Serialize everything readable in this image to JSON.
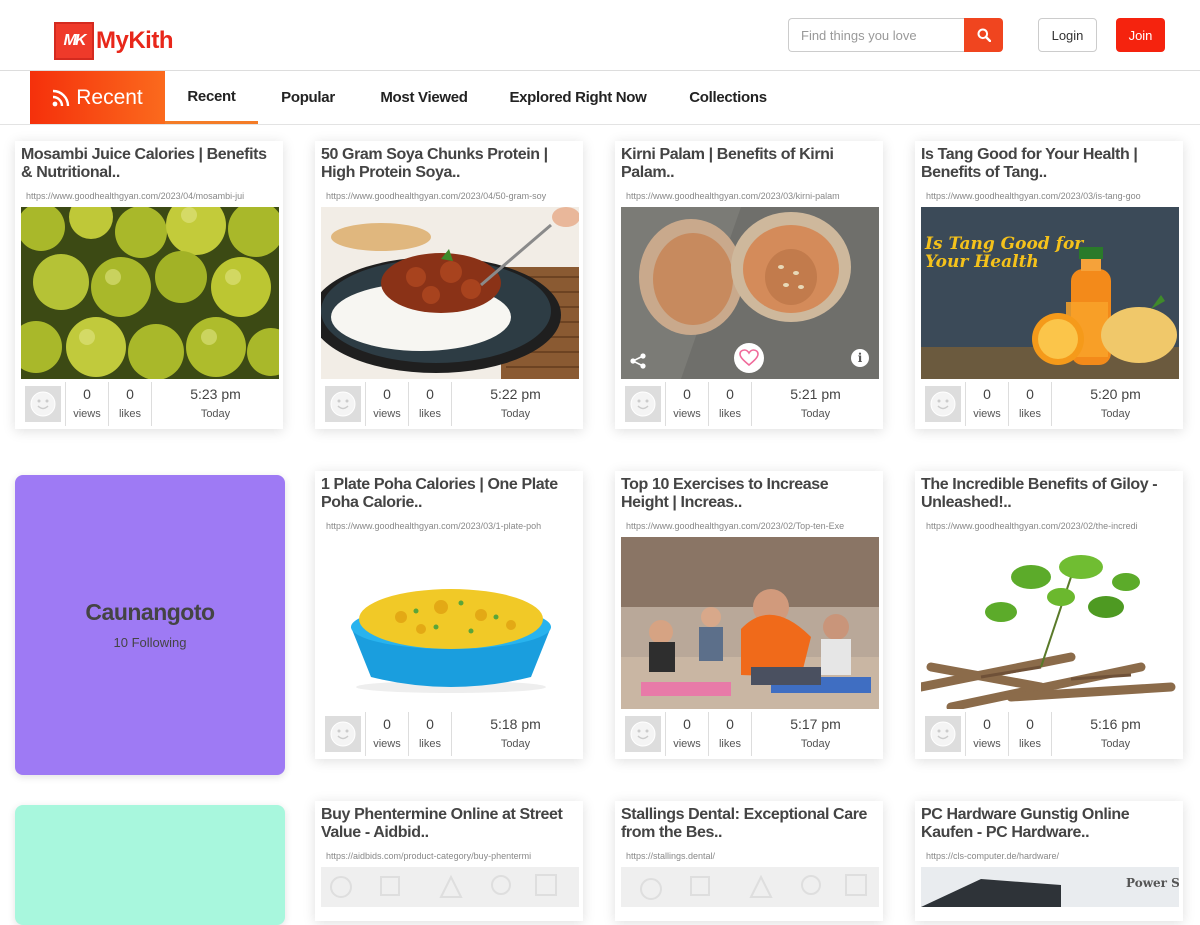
{
  "brand": {
    "name": "MyKith",
    "mark": "MK"
  },
  "search": {
    "placeholder": "Find things you love"
  },
  "auth": {
    "login_label": "Login",
    "join_label": "Join"
  },
  "tabs": {
    "main_label": "Recent",
    "items": [
      "Recent",
      "Popular",
      "Most Viewed",
      "Explored Right Now",
      "Collections"
    ]
  },
  "colors": {
    "accent": "#f5300b",
    "join": "#f5230e",
    "follow_purple": "#9e7af4",
    "follow_mint": "#a8f7dd"
  },
  "follow": {
    "name": "Caunangoto",
    "sub": "10 Following"
  },
  "cards": [
    {
      "title": "Mosambi Juice Calories | Benefits & Nutritional..",
      "url": "https://www.goodhealthgyan.com/2023/04/mosambi-jui",
      "views": "0",
      "likes": "0",
      "time": "5:23 pm",
      "day": "Today"
    },
    {
      "title": "50 Gram Soya Chunks Protein | High Protein Soya..",
      "url": "https://www.goodhealthgyan.com/2023/04/50-gram-soy",
      "views": "0",
      "likes": "0",
      "time": "5:22 pm",
      "day": "Today"
    },
    {
      "title": "Kirni Palam | Benefits of Kirni Palam..",
      "url": "https://www.goodhealthgyan.com/2023/03/kirni-palam",
      "views": "0",
      "likes": "0",
      "time": "5:21 pm",
      "day": "Today"
    },
    {
      "title": "Is Tang Good for Your Health | Benefits of Tang..",
      "url": "https://www.goodhealthgyan.com/2023/03/is-tang-goo",
      "views": "0",
      "likes": "0",
      "time": "5:20 pm",
      "day": "Today",
      "image_text": "Is Tang Good for Your Health"
    },
    {
      "title": "1 Plate Poha Calories | One Plate Poha Calorie..",
      "url": "https://www.goodhealthgyan.com/2023/03/1-plate-poh",
      "views": "0",
      "likes": "0",
      "time": "5:18 pm",
      "day": "Today"
    },
    {
      "title": "Top 10 Exercises to Increase Height | Increas..",
      "url": "https://www.goodhealthgyan.com/2023/02/Top-ten-Exe",
      "views": "0",
      "likes": "0",
      "time": "5:17 pm",
      "day": "Today"
    },
    {
      "title": "The Incredible Benefits of Giloy - Unleashed!..",
      "url": "https://www.goodhealthgyan.com/2023/02/the-incredi",
      "views": "0",
      "likes": "0",
      "time": "5:16 pm",
      "day": "Today"
    },
    {
      "title": "Buy Phentermine Online at Street Value - Aidbid..",
      "url": "https://aidbids.com/product-category/buy-phentermi"
    },
    {
      "title": "Stallings Dental: Exceptional Care from the Bes..",
      "url": "https://stallings.dental/"
    },
    {
      "title": "PC Hardware Gunstig Online Kaufen - PC Hardware..",
      "url": "https://cls-computer.de/hardware/",
      "image_text": "Power Sup"
    }
  ],
  "labels": {
    "views": "views",
    "likes": "likes"
  }
}
